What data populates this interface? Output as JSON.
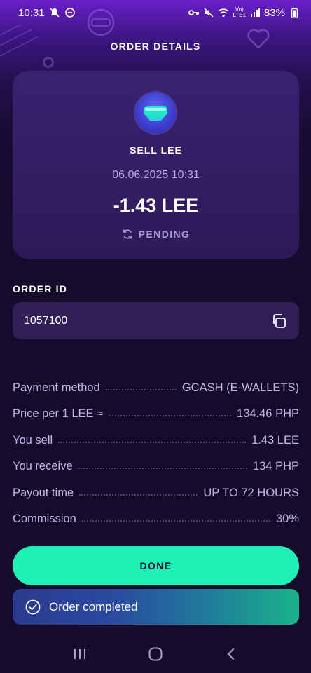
{
  "status_bar": {
    "time": "10:31",
    "battery": "83%",
    "left_icons": [
      "notification-icon",
      "dnd-icon"
    ],
    "right_icons": [
      "key-icon",
      "mute-icon",
      "wifi-icon",
      "volte-icon",
      "signal-icon",
      "battery-icon"
    ]
  },
  "header": {
    "title": "ORDER DETAILS"
  },
  "summary": {
    "coin_icon": "goggles-icon",
    "title": "SELL LEE",
    "date": "06.06.2025 10:31",
    "amount": "-1.43 LEE",
    "status": "PENDING"
  },
  "order": {
    "label": "ORDER ID",
    "value": "1057100",
    "copy_icon": "copy-icon"
  },
  "details": [
    {
      "label": "Payment method",
      "value": "GCASH (E-WALLETS)"
    },
    {
      "label": "Price per 1 LEE ≈",
      "value": "134.46 PHP"
    },
    {
      "label": "You sell",
      "value": "1.43 LEE"
    },
    {
      "label": "You receive",
      "value": "134 PHP"
    },
    {
      "label": "Payout time",
      "value": "UP TO 72 HOURS"
    },
    {
      "label": "Commission",
      "value": "30%"
    }
  ],
  "done_button": {
    "label": "DONE"
  },
  "toast": {
    "text": "Order completed"
  },
  "colors": {
    "accent": "#1ef0b6",
    "background": "#150b2a",
    "card": "#2c1a58",
    "muted_text": "#c2b6e6"
  }
}
